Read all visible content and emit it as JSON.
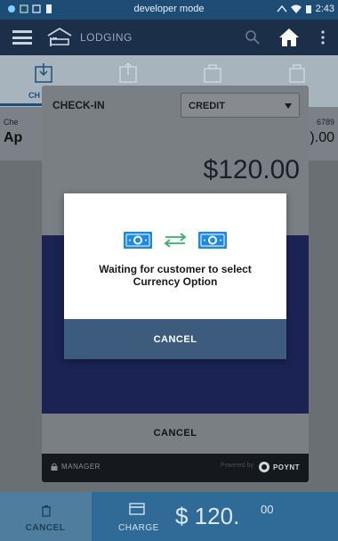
{
  "status_bar": {
    "center": "developer mode",
    "time": "2:43"
  },
  "app_bar": {
    "title": "LODGING"
  },
  "tabs": [
    {
      "label": "CH"
    }
  ],
  "background_row": {
    "left_small": "Che",
    "left_big": "Ap",
    "right_small": "6789",
    "right_big": ").00"
  },
  "sheet": {
    "checkin_label": "CHECK-IN",
    "payment_select": "CREDIT",
    "amount": "$120.00",
    "bottom_cancel": "CANCEL",
    "footer_manager": "MANAGER",
    "footer_powered": "Powered by",
    "footer_brand": "POYNT"
  },
  "dialog": {
    "message_line1": "Waiting for customer to select",
    "message_line2": "Currency Option",
    "cancel_label": "CANCEL"
  },
  "bottom_bar": {
    "cancel_label": "CANCEL",
    "charge_label": "CHARGE",
    "amount_main": "$ 120.",
    "amount_cents": "00"
  },
  "colors": {
    "dialog_cancel": "#3d5b7d",
    "currency_icon": "#1e88e5",
    "swap_arrows": "#2fb56a",
    "blue_panel": "#1a2354"
  }
}
